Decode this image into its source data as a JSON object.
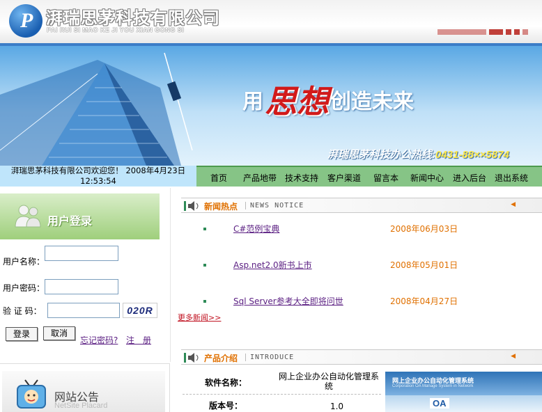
{
  "header": {
    "company_name": "湃瑞思茅科技有限公司",
    "company_pinyin": "PAI RUI SI MAO KE JI YOU XIAN GONG SI",
    "logo_letter": "P",
    "brand_blue": "#1a5fb1",
    "accent_red": "#c0403a"
  },
  "banner": {
    "slogan_pre": "用",
    "slogan_main": "思想",
    "slogan_post": "创造未来",
    "hotline_label": "湃瑞思茅科技办公热线:",
    "hotline_number": "0431-88××5874"
  },
  "welcome": {
    "line1": "湃瑞思茅科技有限公司欢迎您！ 2008年4月23日",
    "line2": "12:53:54"
  },
  "nav": {
    "items": [
      "首页",
      "产品地带",
      "技术支持",
      "客户渠道",
      "留言本",
      "新闻中心",
      "进入后台",
      "退出系统"
    ]
  },
  "login": {
    "title": "用户登录",
    "username_label": "用户名称：",
    "password_label": "用户密码：",
    "code_label": "验 证 码：",
    "captcha": "020R",
    "username_value": "",
    "password_value": "",
    "code_value": "",
    "login_button": "登录",
    "cancel_button": "取消",
    "forgot_link": "忘记密码?",
    "register_link": "注　册"
  },
  "notice": {
    "title": "网站公告",
    "subtitle": "NetSite Placard"
  },
  "news": {
    "title_cn": "新闻热点",
    "title_en": "NEWS NOTICE",
    "items": [
      {
        "title": "C#范例宝典",
        "date": "2008年06月03日"
      },
      {
        "title": "Asp.net2.0新书上市",
        "date": "2008年05月01日"
      },
      {
        "title": "Sql Server参考大全即将问世",
        "date": "2008年04月27日"
      }
    ],
    "more": "更多新闻>>"
  },
  "product": {
    "title_cn": "产品介绍",
    "title_en": "INTRODUCE",
    "name_label": "软件名称：",
    "name_value": "网上企业办公自动化管理系统",
    "version_label": "版本号：",
    "version_value": "1.0",
    "screenshot_title": "网上企业办公自动化管理系统",
    "screenshot_subtitle": "Corporation OA Manage System in Network",
    "screenshot_badge": "OA"
  }
}
